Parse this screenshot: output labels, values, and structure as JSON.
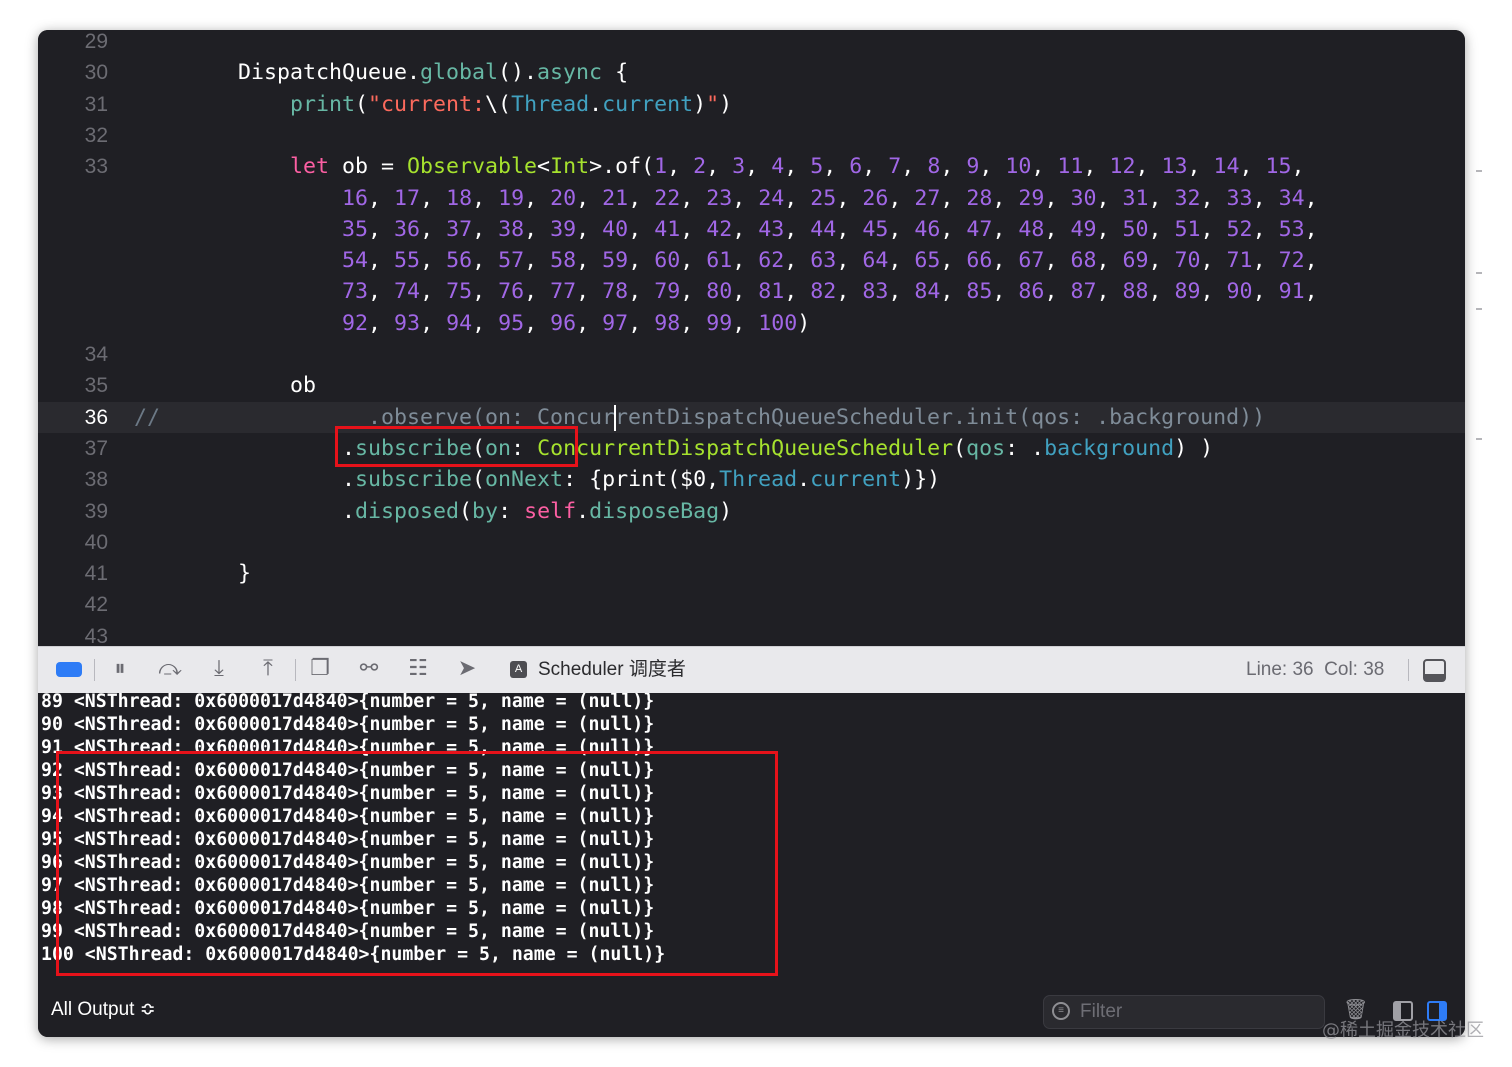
{
  "editor": {
    "lines": [
      {
        "num": "29",
        "tokens": []
      },
      {
        "num": "30",
        "tokens": [
          [
            "p",
            "        DispatchQueue."
          ],
          [
            "h",
            "global"
          ],
          [
            "p",
            "()."
          ],
          [
            "h",
            "async"
          ],
          [
            "p",
            " {"
          ]
        ]
      },
      {
        "num": "31",
        "tokens": [
          [
            "h",
            "            print"
          ],
          [
            "p",
            "("
          ],
          [
            "s",
            "\"current:"
          ],
          [
            "p",
            "\\("
          ],
          [
            "m",
            "Thread"
          ],
          [
            "p",
            "."
          ],
          [
            "m",
            "current"
          ],
          [
            "p",
            ")"
          ],
          [
            "s",
            "\""
          ],
          [
            "p",
            ")"
          ]
        ]
      },
      {
        "num": "32",
        "tokens": []
      },
      {
        "num": "33",
        "tokens": [
          [
            "k",
            "            let"
          ],
          [
            "p",
            " ob = "
          ],
          [
            "g",
            "Observable"
          ],
          [
            "p",
            "<"
          ],
          [
            "g",
            "Int"
          ],
          [
            "p",
            ">.of("
          ],
          [
            "y",
            "1"
          ],
          [
            "p",
            ", "
          ],
          [
            "y",
            "2"
          ],
          [
            "p",
            ", "
          ],
          [
            "y",
            "3"
          ],
          [
            "p",
            ", "
          ],
          [
            "y",
            "4"
          ],
          [
            "p",
            ", "
          ],
          [
            "y",
            "5"
          ],
          [
            "p",
            ", "
          ],
          [
            "y",
            "6"
          ],
          [
            "p",
            ", "
          ],
          [
            "y",
            "7"
          ],
          [
            "p",
            ", "
          ],
          [
            "y",
            "8"
          ],
          [
            "p",
            ", "
          ],
          [
            "y",
            "9"
          ],
          [
            "p",
            ", "
          ],
          [
            "y",
            "10"
          ],
          [
            "p",
            ", "
          ],
          [
            "y",
            "11"
          ],
          [
            "p",
            ", "
          ],
          [
            "y",
            "12"
          ],
          [
            "p",
            ", "
          ],
          [
            "y",
            "13"
          ],
          [
            "p",
            ", "
          ],
          [
            "y",
            "14"
          ],
          [
            "p",
            ", "
          ],
          [
            "y",
            "15"
          ],
          [
            "p",
            ","
          ]
        ]
      },
      {
        "num": "",
        "tokens": [
          [
            "p",
            "                "
          ],
          [
            "y",
            "16"
          ],
          [
            "p",
            ", "
          ],
          [
            "y",
            "17"
          ],
          [
            "p",
            ", "
          ],
          [
            "y",
            "18"
          ],
          [
            "p",
            ", "
          ],
          [
            "y",
            "19"
          ],
          [
            "p",
            ", "
          ],
          [
            "y",
            "20"
          ],
          [
            "p",
            ", "
          ],
          [
            "y",
            "21"
          ],
          [
            "p",
            ", "
          ],
          [
            "y",
            "22"
          ],
          [
            "p",
            ", "
          ],
          [
            "y",
            "23"
          ],
          [
            "p",
            ", "
          ],
          [
            "y",
            "24"
          ],
          [
            "p",
            ", "
          ],
          [
            "y",
            "25"
          ],
          [
            "p",
            ", "
          ],
          [
            "y",
            "26"
          ],
          [
            "p",
            ", "
          ],
          [
            "y",
            "27"
          ],
          [
            "p",
            ", "
          ],
          [
            "y",
            "28"
          ],
          [
            "p",
            ", "
          ],
          [
            "y",
            "29"
          ],
          [
            "p",
            ", "
          ],
          [
            "y",
            "30"
          ],
          [
            "p",
            ", "
          ],
          [
            "y",
            "31"
          ],
          [
            "p",
            ", "
          ],
          [
            "y",
            "32"
          ],
          [
            "p",
            ", "
          ],
          [
            "y",
            "33"
          ],
          [
            "p",
            ", "
          ],
          [
            "y",
            "34"
          ],
          [
            "p",
            ","
          ]
        ]
      },
      {
        "num": "",
        "tokens": [
          [
            "p",
            "                "
          ],
          [
            "y",
            "35"
          ],
          [
            "p",
            ", "
          ],
          [
            "y",
            "36"
          ],
          [
            "p",
            ", "
          ],
          [
            "y",
            "37"
          ],
          [
            "p",
            ", "
          ],
          [
            "y",
            "38"
          ],
          [
            "p",
            ", "
          ],
          [
            "y",
            "39"
          ],
          [
            "p",
            ", "
          ],
          [
            "y",
            "40"
          ],
          [
            "p",
            ", "
          ],
          [
            "y",
            "41"
          ],
          [
            "p",
            ", "
          ],
          [
            "y",
            "42"
          ],
          [
            "p",
            ", "
          ],
          [
            "y",
            "43"
          ],
          [
            "p",
            ", "
          ],
          [
            "y",
            "44"
          ],
          [
            "p",
            ", "
          ],
          [
            "y",
            "45"
          ],
          [
            "p",
            ", "
          ],
          [
            "y",
            "46"
          ],
          [
            "p",
            ", "
          ],
          [
            "y",
            "47"
          ],
          [
            "p",
            ", "
          ],
          [
            "y",
            "48"
          ],
          [
            "p",
            ", "
          ],
          [
            "y",
            "49"
          ],
          [
            "p",
            ", "
          ],
          [
            "y",
            "50"
          ],
          [
            "p",
            ", "
          ],
          [
            "y",
            "51"
          ],
          [
            "p",
            ", "
          ],
          [
            "y",
            "52"
          ],
          [
            "p",
            ", "
          ],
          [
            "y",
            "53"
          ],
          [
            "p",
            ","
          ]
        ]
      },
      {
        "num": "",
        "tokens": [
          [
            "p",
            "                "
          ],
          [
            "y",
            "54"
          ],
          [
            "p",
            ", "
          ],
          [
            "y",
            "55"
          ],
          [
            "p",
            ", "
          ],
          [
            "y",
            "56"
          ],
          [
            "p",
            ", "
          ],
          [
            "y",
            "57"
          ],
          [
            "p",
            ", "
          ],
          [
            "y",
            "58"
          ],
          [
            "p",
            ", "
          ],
          [
            "y",
            "59"
          ],
          [
            "p",
            ", "
          ],
          [
            "y",
            "60"
          ],
          [
            "p",
            ", "
          ],
          [
            "y",
            "61"
          ],
          [
            "p",
            ", "
          ],
          [
            "y",
            "62"
          ],
          [
            "p",
            ", "
          ],
          [
            "y",
            "63"
          ],
          [
            "p",
            ", "
          ],
          [
            "y",
            "64"
          ],
          [
            "p",
            ", "
          ],
          [
            "y",
            "65"
          ],
          [
            "p",
            ", "
          ],
          [
            "y",
            "66"
          ],
          [
            "p",
            ", "
          ],
          [
            "y",
            "67"
          ],
          [
            "p",
            ", "
          ],
          [
            "y",
            "68"
          ],
          [
            "p",
            ", "
          ],
          [
            "y",
            "69"
          ],
          [
            "p",
            ", "
          ],
          [
            "y",
            "70"
          ],
          [
            "p",
            ", "
          ],
          [
            "y",
            "71"
          ],
          [
            "p",
            ", "
          ],
          [
            "y",
            "72"
          ],
          [
            "p",
            ","
          ]
        ]
      },
      {
        "num": "",
        "tokens": [
          [
            "p",
            "                "
          ],
          [
            "y",
            "73"
          ],
          [
            "p",
            ", "
          ],
          [
            "y",
            "74"
          ],
          [
            "p",
            ", "
          ],
          [
            "y",
            "75"
          ],
          [
            "p",
            ", "
          ],
          [
            "y",
            "76"
          ],
          [
            "p",
            ", "
          ],
          [
            "y",
            "77"
          ],
          [
            "p",
            ", "
          ],
          [
            "y",
            "78"
          ],
          [
            "p",
            ", "
          ],
          [
            "y",
            "79"
          ],
          [
            "p",
            ", "
          ],
          [
            "y",
            "80"
          ],
          [
            "p",
            ", "
          ],
          [
            "y",
            "81"
          ],
          [
            "p",
            ", "
          ],
          [
            "y",
            "82"
          ],
          [
            "p",
            ", "
          ],
          [
            "y",
            "83"
          ],
          [
            "p",
            ", "
          ],
          [
            "y",
            "84"
          ],
          [
            "p",
            ", "
          ],
          [
            "y",
            "85"
          ],
          [
            "p",
            ", "
          ],
          [
            "y",
            "86"
          ],
          [
            "p",
            ", "
          ],
          [
            "y",
            "87"
          ],
          [
            "p",
            ", "
          ],
          [
            "y",
            "88"
          ],
          [
            "p",
            ", "
          ],
          [
            "y",
            "89"
          ],
          [
            "p",
            ", "
          ],
          [
            "y",
            "90"
          ],
          [
            "p",
            ", "
          ],
          [
            "y",
            "91"
          ],
          [
            "p",
            ","
          ]
        ]
      },
      {
        "num": "",
        "tokens": [
          [
            "p",
            "                "
          ],
          [
            "y",
            "92"
          ],
          [
            "p",
            ", "
          ],
          [
            "y",
            "93"
          ],
          [
            "p",
            ", "
          ],
          [
            "y",
            "94"
          ],
          [
            "p",
            ", "
          ],
          [
            "y",
            "95"
          ],
          [
            "p",
            ", "
          ],
          [
            "y",
            "96"
          ],
          [
            "p",
            ", "
          ],
          [
            "y",
            "97"
          ],
          [
            "p",
            ", "
          ],
          [
            "y",
            "98"
          ],
          [
            "p",
            ", "
          ],
          [
            "y",
            "99"
          ],
          [
            "p",
            ", "
          ],
          [
            "y",
            "100"
          ],
          [
            "p",
            ")"
          ]
        ]
      },
      {
        "num": "34",
        "tokens": []
      },
      {
        "num": "35",
        "tokens": [
          [
            "p",
            "            ob"
          ]
        ]
      },
      {
        "num": "36",
        "current": true,
        "tokens": [
          [
            "c",
            "//"
          ],
          [
            "h",
            "                .observe(on: Concur"
          ],
          [
            "caret",
            ""
          ],
          [
            "h",
            "rentDispatchQueueScheduler.init(qos: .background))"
          ]
        ]
      },
      {
        "num": "37",
        "tokens": [
          [
            "p",
            "                ."
          ],
          [
            "h",
            "subscribe"
          ],
          [
            "p",
            "("
          ],
          [
            "h",
            "on"
          ],
          [
            "p",
            ": "
          ],
          [
            "g",
            "ConcurrentDispatchQueueScheduler"
          ],
          [
            "p",
            "("
          ],
          [
            "h",
            "qos"
          ],
          [
            "p",
            ": ."
          ],
          [
            "m",
            "background"
          ],
          [
            "p",
            ") )"
          ]
        ]
      },
      {
        "num": "38",
        "tokens": [
          [
            "p",
            "                ."
          ],
          [
            "h",
            "subscribe"
          ],
          [
            "p",
            "("
          ],
          [
            "h",
            "onNext"
          ],
          [
            "p",
            ": {print($0,"
          ],
          [
            "m",
            "Thread"
          ],
          [
            "p",
            "."
          ],
          [
            "m",
            "current"
          ],
          [
            "p",
            ")})"
          ]
        ]
      },
      {
        "num": "39",
        "tokens": [
          [
            "p",
            "                ."
          ],
          [
            "h",
            "disposed"
          ],
          [
            "p",
            "("
          ],
          [
            "h",
            "by"
          ],
          [
            "p",
            ": "
          ],
          [
            "k",
            "self"
          ],
          [
            "p",
            "."
          ],
          [
            "h",
            "disposeBag"
          ],
          [
            "p",
            ")"
          ]
        ]
      },
      {
        "num": "40",
        "tokens": []
      },
      {
        "num": "41",
        "tokens": [
          [
            "p",
            "        }"
          ]
        ]
      },
      {
        "num": "42",
        "tokens": []
      },
      {
        "num": "43",
        "tokens": []
      }
    ]
  },
  "debugbar": {
    "scheme": "Scheduler 调度者",
    "line_col": "Line: 36  Col: 38"
  },
  "console": {
    "lines": [
      "89 <NSThread: 0x6000017d4840>{number = 5, name = (null)}",
      "90 <NSThread: 0x6000017d4840>{number = 5, name = (null)}",
      "91 <NSThread: 0x6000017d4840>{number = 5, name = (null)}",
      "92 <NSThread: 0x6000017d4840>{number = 5, name = (null)}",
      "93 <NSThread: 0x6000017d4840>{number = 5, name = (null)}",
      "94 <NSThread: 0x6000017d4840>{number = 5, name = (null)}",
      "95 <NSThread: 0x6000017d4840>{number = 5, name = (null)}",
      "96 <NSThread: 0x6000017d4840>{number = 5, name = (null)}",
      "97 <NSThread: 0x6000017d4840>{number = 5, name = (null)}",
      "98 <NSThread: 0x6000017d4840>{number = 5, name = (null)}",
      "99 <NSThread: 0x6000017d4840>{number = 5, name = (null)}",
      "100 <NSThread: 0x6000017d4840>{number = 5, name = (null)}"
    ]
  },
  "bottombar": {
    "output_selector": "All Output ≎",
    "filter_placeholder": "Filter"
  },
  "watermark": "@稀土掘金技术社区",
  "colors": {
    "editor_bg": "#1f1f24",
    "annotation_red": "#e6121a",
    "accent_blue": "#2e7cf6"
  }
}
